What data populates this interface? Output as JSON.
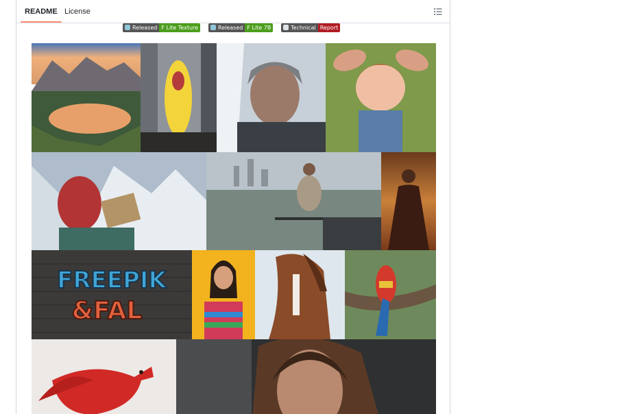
{
  "tabs": [
    {
      "label": "README",
      "active": true
    },
    {
      "label": "License",
      "active": false
    }
  ],
  "toc_icon": "list-unordered-icon",
  "badges": [
    {
      "label": "Released",
      "message": "F Lite Texture",
      "color": "#4c9e1c",
      "icon": "model-icon"
    },
    {
      "label": "Released",
      "message": "F Lite 7B",
      "color": "#4c9e1c",
      "icon": "model-icon"
    },
    {
      "label": "Technical",
      "message": "Report",
      "color": "#b01e24",
      "icon": "document-icon"
    }
  ],
  "gallery": {
    "tiles": [
      {
        "name": "gallery-image-mountain-lake"
      },
      {
        "name": "gallery-image-banana-monster"
      },
      {
        "name": "gallery-image-old-man-snow"
      },
      {
        "name": "gallery-image-rabbit-eared-character"
      },
      {
        "name": "gallery-image-climber-reading"
      },
      {
        "name": "gallery-image-woman-railing"
      },
      {
        "name": "gallery-image-desert-woman"
      },
      {
        "name": "gallery-image-graffiti-wall",
        "text_line1": "FREEPIK",
        "text_line2": "&FAL"
      },
      {
        "name": "gallery-image-girl-rainbow-sweater"
      },
      {
        "name": "gallery-image-horse"
      },
      {
        "name": "gallery-image-parrot"
      },
      {
        "name": "gallery-image-strawberry-bird"
      },
      {
        "name": "gallery-image-woman-portrait"
      }
    ]
  }
}
